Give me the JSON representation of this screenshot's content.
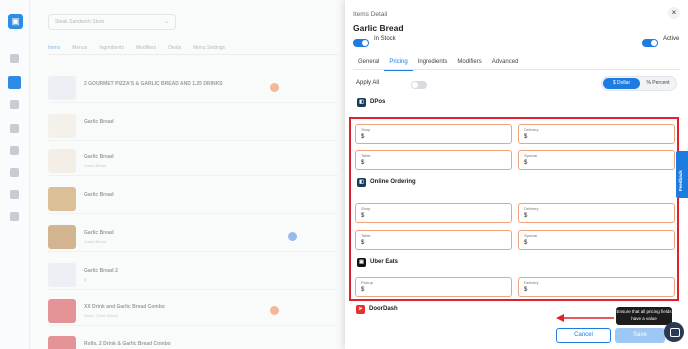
{
  "background": {
    "store_selector": "Steak Sandwich Store",
    "tabs": [
      "Items",
      "Menus",
      "Ingredients",
      "Modifiers",
      "Deals",
      "Menu Settings"
    ],
    "rows": [
      {
        "name": "2 GOURMET PIZZA'S & GARLIC BREAD AND 1.25 DRINKS",
        "sub": ""
      },
      {
        "name": "Garlic Bread",
        "sub": ""
      },
      {
        "name": "Garlic Bread",
        "sub": "Garlic Bread"
      },
      {
        "name": "Garlic Bread",
        "sub": ""
      },
      {
        "name": "Garlic Bread",
        "sub": "Garlic Bread"
      },
      {
        "name": "Garlic Bread 2",
        "sub": "$"
      },
      {
        "name": "XX Drink and Garlic Bread Combo",
        "sub": "Drink, Garlic Bread"
      },
      {
        "name": "Rolls, 2 Drink & Garlic Bread Combo",
        "sub": ""
      }
    ]
  },
  "drawer": {
    "title": "Items Detail",
    "item_name": "Garlic Bread",
    "in_stock_label": "In Stock",
    "active_label": "Active",
    "close_glyph": "×",
    "tabs": [
      "General",
      "Pricing",
      "Ingredients",
      "Modifiers",
      "Advanced"
    ],
    "apply_all_label": "Apply All",
    "currency_toggle": {
      "dollar": "$ Dollar",
      "percent": "% Percent"
    },
    "sections": {
      "dpos": {
        "title": "DPos",
        "fields": {
          "shop": {
            "label": "Shop",
            "value": "$"
          },
          "delivery": {
            "label": "Delivery",
            "value": "$"
          },
          "table": {
            "label": "Table",
            "value": "$"
          },
          "special": {
            "label": "Special",
            "value": "$"
          }
        }
      },
      "online": {
        "title": "Online Ordering",
        "fields": {
          "shop": {
            "label": "Shop",
            "value": "$"
          },
          "delivery": {
            "label": "Delivery",
            "value": "$"
          },
          "table": {
            "label": "Table",
            "value": "$"
          },
          "special": {
            "label": "Special",
            "value": "$"
          }
        }
      },
      "uber": {
        "title": "Uber Eats",
        "fields": {
          "pickup": {
            "label": "Pickup",
            "value": "$"
          },
          "delivery": {
            "label": "Delivery",
            "value": "$"
          }
        }
      },
      "doordash": {
        "title": "DoorDash"
      }
    },
    "feedback_label": "Feedback",
    "cancel_label": "Cancel",
    "save_label": "Save",
    "tooltip": "Ensure that all pricing fields have a value"
  },
  "colors": {
    "accent": "#1e7ce0",
    "highlight_border": "#e0202a",
    "field_border": "#f0a37c",
    "doordash": "#e5322d"
  }
}
